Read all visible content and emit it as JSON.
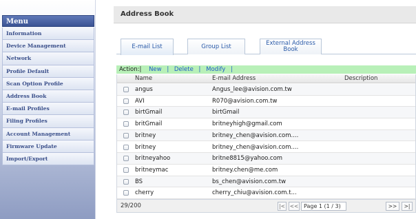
{
  "sidebar": {
    "header": "Menu",
    "items": [
      {
        "label": "Information"
      },
      {
        "label": "Device Management"
      },
      {
        "label": "Network"
      },
      {
        "label": "Profile Default"
      },
      {
        "label": "Scan Option Profile"
      },
      {
        "label": "Address Book"
      },
      {
        "label": "E-mail Profiles"
      },
      {
        "label": "Filing Profiles"
      },
      {
        "label": "Account Management"
      },
      {
        "label": "Firmware Update"
      },
      {
        "label": "Import/Export"
      }
    ]
  },
  "page": {
    "title": "Address Book"
  },
  "tabs": [
    {
      "label": "E-mail List"
    },
    {
      "label": "Group List"
    },
    {
      "label": "External Address Book"
    }
  ],
  "actions": {
    "prefix": "Action:|",
    "new": "New",
    "delete": "Delete",
    "modify": "Modify",
    "sep": "|"
  },
  "table": {
    "headers": {
      "name": "Name",
      "email": "E-mail Address",
      "description": "Description"
    },
    "rows": [
      {
        "name": "angus",
        "email": "Angus_lee@avision.com.tw"
      },
      {
        "name": "AVI",
        "email": "R070@avision.com.tw"
      },
      {
        "name": "birtGmail",
        "email": "birtGmail"
      },
      {
        "name": "britGmail",
        "email": "britneyhigh@gmail.com"
      },
      {
        "name": "britney",
        "email": "britney_chen@avision.com...."
      },
      {
        "name": "britney",
        "email": "britney_chen@avision.com...."
      },
      {
        "name": "britneyahoo",
        "email": "britne8815@yahoo.com"
      },
      {
        "name": "britneymac",
        "email": "britney.chen@me.com"
      },
      {
        "name": "BS",
        "email": "bs_chen@avision.com.tw"
      },
      {
        "name": "cherry",
        "email": "cherry_chiu@avision.com.t..."
      }
    ]
  },
  "footer": {
    "count": "29/200",
    "page_label": "Page 1 (1 / 3)",
    "first": "|<",
    "prev": "<<",
    "next": ">>",
    "last": ">|"
  }
}
